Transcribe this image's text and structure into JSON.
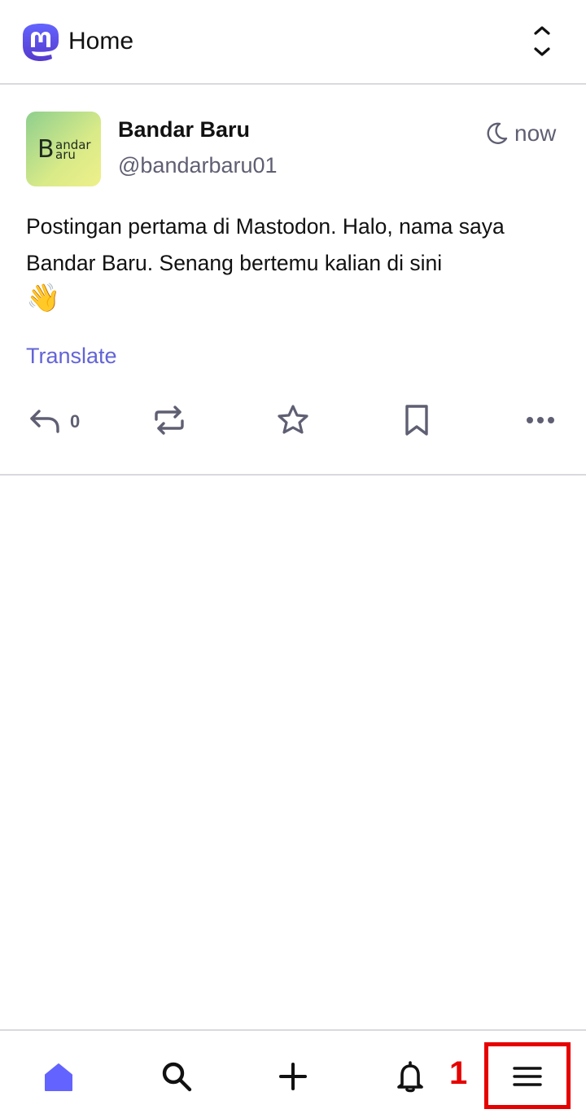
{
  "header": {
    "title": "Home",
    "logo_icon": "mastodon-logo",
    "collapse_icon": "chevron-up-down-icon"
  },
  "post": {
    "avatar_text": "Bandar Baru",
    "display_name": "Bandar Baru",
    "handle": "@bandarbaru01",
    "visibility_icon": "moon-icon",
    "time": "now",
    "text": "Postingan pertama di Mastodon. Halo, nama saya Bandar Baru. Senang bertemu kalian di sini",
    "emoji": "👋",
    "translate_label": "Translate",
    "reply_count": "0",
    "actions": [
      "reply-icon",
      "boost-icon",
      "star-icon",
      "bookmark-icon",
      "more-icon"
    ]
  },
  "bottom_nav": {
    "items": [
      "home-icon",
      "search-icon",
      "compose-icon",
      "bell-icon",
      "menu-icon"
    ],
    "annotation_number": "1"
  },
  "colors": {
    "accent": "#6364ff",
    "link": "#6364d6",
    "muted": "#5f5f73",
    "annotation": "#e60000",
    "divider": "#d9d9de"
  }
}
